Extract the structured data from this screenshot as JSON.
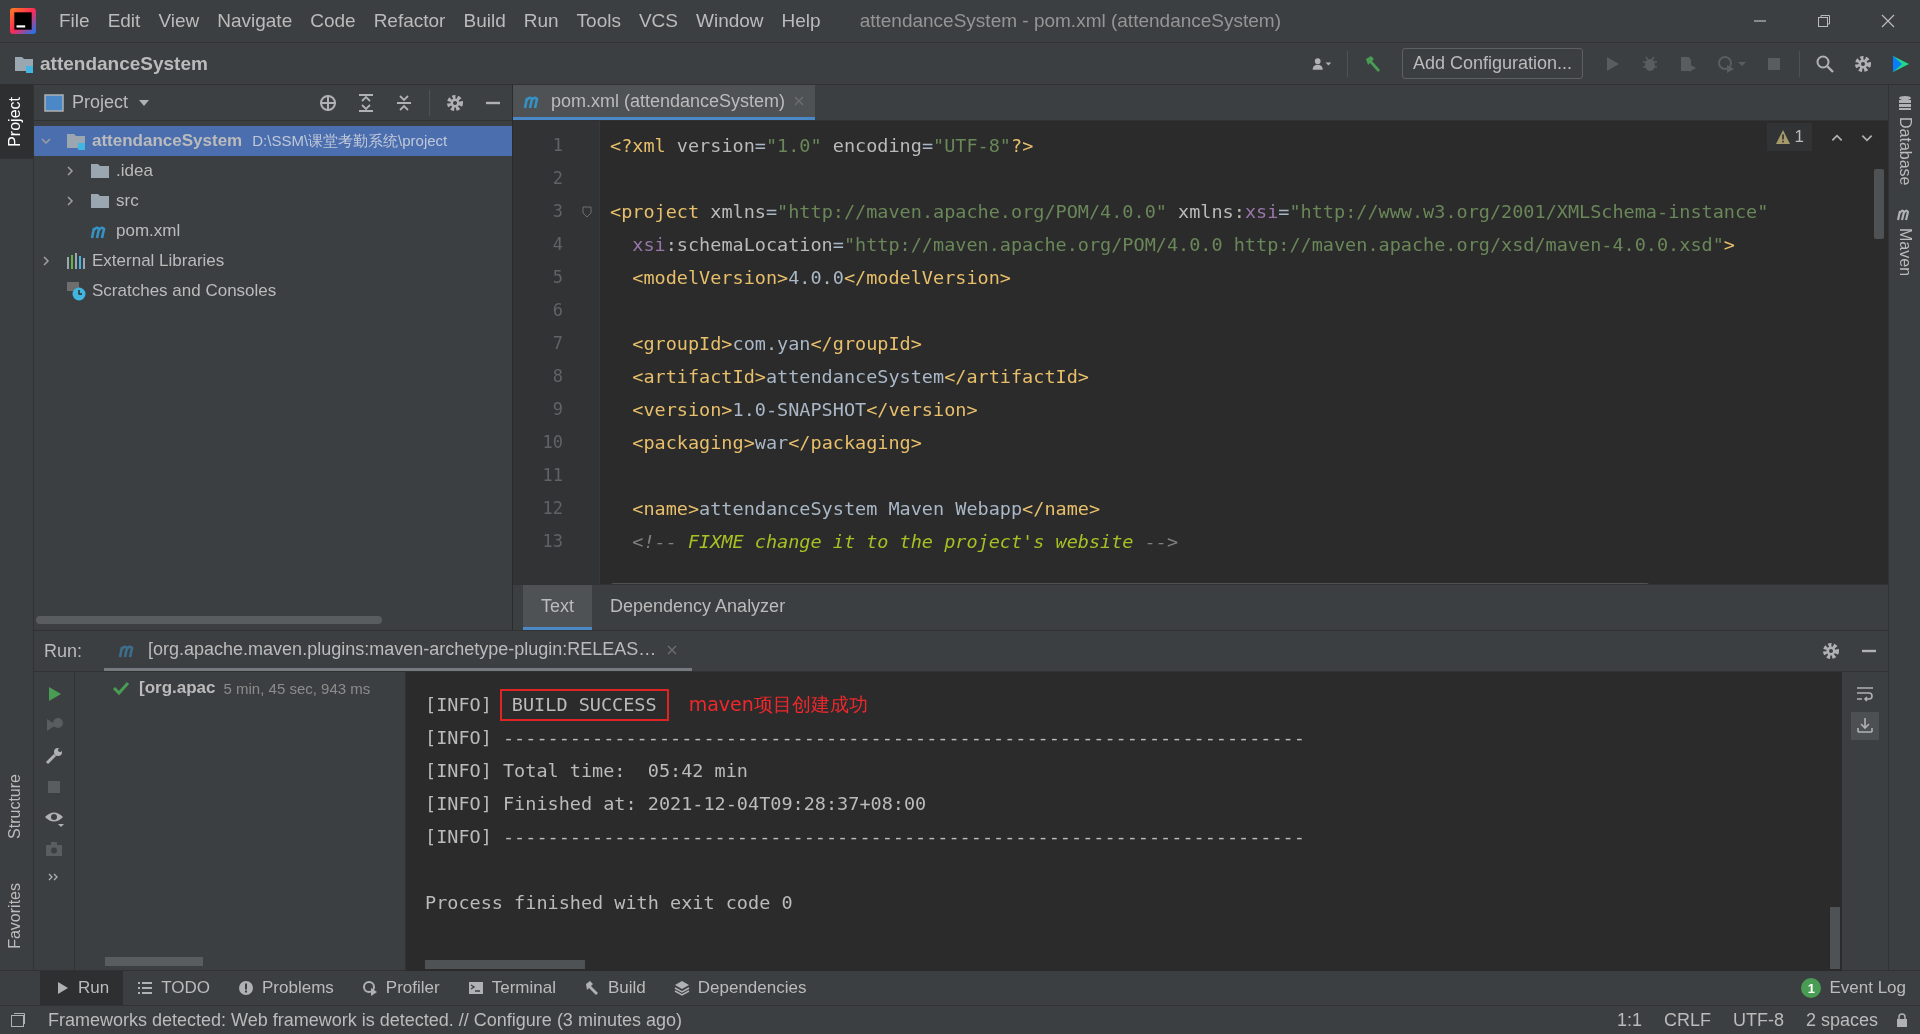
{
  "window": {
    "title": "attendanceSystem - pom.xml (attendanceSystem)"
  },
  "menu": [
    "File",
    "Edit",
    "View",
    "Navigate",
    "Code",
    "Refactor",
    "Build",
    "Run",
    "Tools",
    "VCS",
    "Window",
    "Help"
  ],
  "navbar": {
    "project": "attendanceSystem",
    "run_config": "Add Configuration..."
  },
  "left_strip": [
    {
      "label": "Project",
      "selected": true
    },
    {
      "label": "Structure",
      "selected": false
    },
    {
      "label": "Favorites",
      "selected": false
    }
  ],
  "right_strip": [
    {
      "label": "Database"
    },
    {
      "label": "Maven"
    }
  ],
  "project_panel": {
    "title": "Project",
    "tree": [
      {
        "name": "attendanceSystem",
        "path": "D:\\SSM\\课堂考勤系统\\project",
        "kind": "module",
        "expanded": true,
        "selected": true,
        "children": [
          {
            "name": ".idea",
            "kind": "folder",
            "expanded": false,
            "selected": false
          },
          {
            "name": "src",
            "kind": "folder",
            "expanded": false,
            "selected": false
          },
          {
            "name": "pom.xml",
            "kind": "maven",
            "selected": false
          }
        ]
      },
      {
        "name": "External Libraries",
        "kind": "libraries",
        "expanded": false,
        "selected": false
      },
      {
        "name": "Scratches and Consoles",
        "kind": "scratches",
        "selected": false
      }
    ]
  },
  "editor": {
    "tab": "pom.xml (attendanceSystem)",
    "warnings": "1",
    "lines": [
      {
        "number": "1",
        "indent": false,
        "tokens": [
          {
            "kind": "tag",
            "text": "<?xml "
          },
          {
            "kind": "attr",
            "text": "version"
          },
          {
            "kind": "text",
            "text": "="
          },
          {
            "kind": "value",
            "text": "\"1.0\""
          },
          {
            "kind": "attr",
            "text": " encoding"
          },
          {
            "kind": "text",
            "text": "="
          },
          {
            "kind": "value",
            "text": "\"UTF-8\""
          },
          {
            "kind": "tag",
            "text": "?>"
          }
        ]
      },
      {
        "number": "2"
      },
      {
        "number": "3",
        "indent": false,
        "tokens": [
          {
            "kind": "tag",
            "text": "<project "
          },
          {
            "kind": "attr",
            "text": "xmlns"
          },
          {
            "kind": "text",
            "text": "="
          },
          {
            "kind": "value",
            "text": "\"http://maven.apache.org/POM/4.0.0\""
          },
          {
            "kind": "attr",
            "text": " xmlns:"
          },
          {
            "kind": "ns",
            "text": "xsi"
          },
          {
            "kind": "text",
            "text": "="
          },
          {
            "kind": "value",
            "text": "\"http://www.w3.org/2001/XMLSchema-instance\""
          }
        ]
      },
      {
        "number": "4",
        "indent": true,
        "tokens": [
          {
            "kind": "ns",
            "text": "xsi"
          },
          {
            "kind": "attr",
            "text": ":schemaLocation"
          },
          {
            "kind": "text",
            "text": "="
          },
          {
            "kind": "value",
            "text": "\"http://maven.apache.org/POM/4.0.0 http://maven.apache.org/xsd/maven-4.0.0.xsd\""
          },
          {
            "kind": "tag",
            "text": ">"
          }
        ]
      },
      {
        "number": "5",
        "indent": true,
        "tokens": [
          {
            "kind": "tag",
            "text": "<modelVersion>"
          },
          {
            "kind": "text",
            "text": "4.0.0"
          },
          {
            "kind": "tag",
            "text": "</modelVersion>"
          }
        ]
      },
      {
        "number": "6"
      },
      {
        "number": "7",
        "indent": true,
        "tokens": [
          {
            "kind": "tag",
            "text": "<groupId>"
          },
          {
            "kind": "text",
            "text": "com.yan"
          },
          {
            "kind": "tag",
            "text": "</groupId>"
          }
        ]
      },
      {
        "number": "8",
        "indent": true,
        "tokens": [
          {
            "kind": "tag",
            "text": "<artifactId>"
          },
          {
            "kind": "text",
            "text": "attendanceSystem"
          },
          {
            "kind": "tag",
            "text": "</artifactId>"
          }
        ]
      },
      {
        "number": "9",
        "indent": true,
        "tokens": [
          {
            "kind": "tag",
            "text": "<version>"
          },
          {
            "kind": "text",
            "text": "1.0-SNAPSHOT"
          },
          {
            "kind": "tag",
            "text": "</version>"
          }
        ]
      },
      {
        "number": "10",
        "indent": true,
        "tokens": [
          {
            "kind": "tag",
            "text": "<packaging>"
          },
          {
            "kind": "text",
            "text": "war"
          },
          {
            "kind": "tag",
            "text": "</packaging>"
          }
        ]
      },
      {
        "number": "11"
      },
      {
        "number": "12",
        "indent": true,
        "tokens": [
          {
            "kind": "tag",
            "text": "<name>"
          },
          {
            "kind": "text",
            "text": "attendanceSystem Maven Webapp"
          },
          {
            "kind": "tag",
            "text": "</name>"
          }
        ]
      },
      {
        "number": "13",
        "indent": true,
        "tokens": [
          {
            "kind": "comment",
            "text": "<!-- "
          },
          {
            "kind": "todo",
            "text": "FIXME change it to the project's website"
          },
          {
            "kind": "comment",
            "text": " -->"
          }
        ]
      }
    ],
    "bottom_tabs": [
      {
        "label": "Text",
        "selected": true
      },
      {
        "label": "Dependency Analyzer",
        "selected": false
      }
    ]
  },
  "run": {
    "label": "Run:",
    "tab": "[org.apache.maven.plugins:maven-archetype-plugin:RELEAS…",
    "tree_item": {
      "name": "[org.apac",
      "duration": "5 min, 45 sec, 943 ms"
    },
    "console": [
      {
        "kind": "highlight",
        "prefix": "[INFO]",
        "text": "BUILD SUCCESS",
        "note": "maven项目创建成功"
      },
      {
        "kind": "plain",
        "text": "[INFO] ------------------------------------------------------------------------"
      },
      {
        "kind": "plain",
        "text": "[INFO] Total time:  05:42 min"
      },
      {
        "kind": "plain",
        "text": "[INFO] Finished at: 2021-12-04T09:28:37+08:00"
      },
      {
        "kind": "plain",
        "text": "[INFO] ------------------------------------------------------------------------"
      },
      {
        "kind": "blank"
      },
      {
        "kind": "plain",
        "text": "Process finished with exit code 0"
      }
    ]
  },
  "tool_tabs": [
    {
      "label": "Run",
      "kind": "run",
      "selected": true
    },
    {
      "label": "TODO",
      "kind": "todo",
      "selected": false
    },
    {
      "label": "Problems",
      "kind": "problems",
      "selected": false
    },
    {
      "label": "Profiler",
      "kind": "profiler",
      "selected": false
    },
    {
      "label": "Terminal",
      "kind": "terminal",
      "selected": false
    },
    {
      "label": "Build",
      "kind": "build",
      "selected": false
    },
    {
      "label": "Dependencies",
      "kind": "dependencies",
      "selected": false
    }
  ],
  "event_log": {
    "label": "Event Log",
    "count": "1"
  },
  "status_bar": {
    "message": "Frameworks detected: Web framework is detected. // Configure (3 minutes ago)",
    "items": [
      "1:1",
      "CRLF",
      "UTF-8",
      "2 spaces"
    ]
  }
}
